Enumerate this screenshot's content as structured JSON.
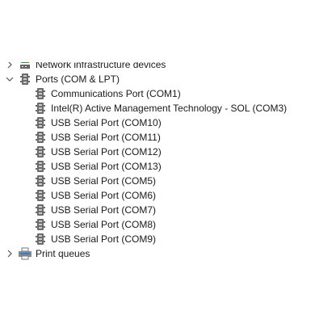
{
  "tree": {
    "clipped_category": {
      "label": "Network infrastructure devices",
      "icon": "network-infrastructure-icon",
      "expanded": false
    },
    "ports_category": {
      "label": "Ports (COM & LPT)",
      "icon": "port-icon",
      "expanded": true,
      "devices": [
        {
          "label": "Communications Port (COM1)",
          "icon": "serial-port-icon"
        },
        {
          "label": "Intel(R) Active Management Technology - SOL (COM3)",
          "icon": "serial-port-icon"
        },
        {
          "label": "USB Serial Port (COM10)",
          "icon": "serial-port-icon"
        },
        {
          "label": "USB Serial Port (COM11)",
          "icon": "serial-port-icon"
        },
        {
          "label": "USB Serial Port (COM12)",
          "icon": "serial-port-icon"
        },
        {
          "label": "USB Serial Port (COM13)",
          "icon": "serial-port-icon"
        },
        {
          "label": "USB Serial Port (COM5)",
          "icon": "serial-port-icon"
        },
        {
          "label": "USB Serial Port (COM6)",
          "icon": "serial-port-icon"
        },
        {
          "label": "USB Serial Port (COM7)",
          "icon": "serial-port-icon"
        },
        {
          "label": "USB Serial Port (COM8)",
          "icon": "serial-port-icon"
        },
        {
          "label": "USB Serial Port (COM9)",
          "icon": "serial-port-icon"
        }
      ]
    },
    "print_queues_category": {
      "label": "Print queues",
      "icon": "printer-icon",
      "expanded": false
    }
  },
  "colors": {
    "text": "#1a1a1a",
    "chevron": "#555555",
    "port_icon": "#6b6b6b",
    "network_icon_green": "#3a9a3a",
    "printer_blue": "#2f7fd1"
  }
}
